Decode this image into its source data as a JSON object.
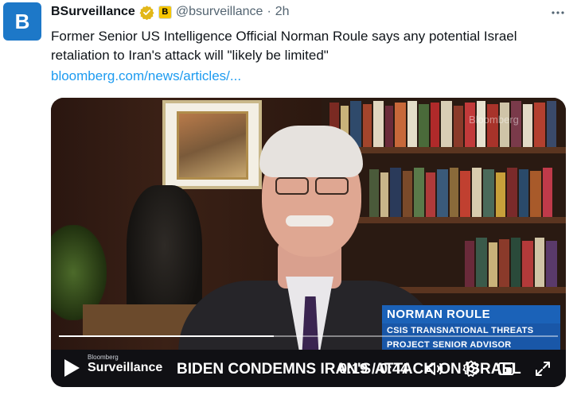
{
  "account": {
    "avatar_letter": "B",
    "display_name": "BSurveillance",
    "affiliate_badge": "B",
    "handle": "@bsurveillance",
    "separator": "·",
    "time": "2h"
  },
  "tweet": {
    "text": "Former Senior US Intelligence Official Norman Roule says any potential Israel retaliation to Iran's attack will \"likely be limited\"",
    "link_text": "bloomberg.com/news/articles/..."
  },
  "video": {
    "watermark": "Bloomberg",
    "lower_third": {
      "name": "NORMAN ROULE",
      "title_line1": "CSIS TRANSNATIONAL THREATS",
      "title_line2": "PROJECT SENIOR ADVISOR"
    },
    "brand_small": "Bloomberg",
    "brand_large": "Surveillance",
    "headline": "BIDEN CONDEMNS IRAN'S ATTACK ON ISRAEL",
    "timestamp": "0:19 / 0:44",
    "progress_fraction": 0.43
  },
  "icons": {
    "more": "more-horizontal-icon",
    "verified": "verified-gold-badge-icon",
    "play": "play-icon",
    "volume": "volume-icon",
    "settings": "settings-gear-icon",
    "fullscreen": "fullscreen-icon"
  },
  "colors": {
    "link": "#1d9bf0",
    "verified_gold": "#e2b719",
    "lower_third_blue": "#1b62b8"
  }
}
